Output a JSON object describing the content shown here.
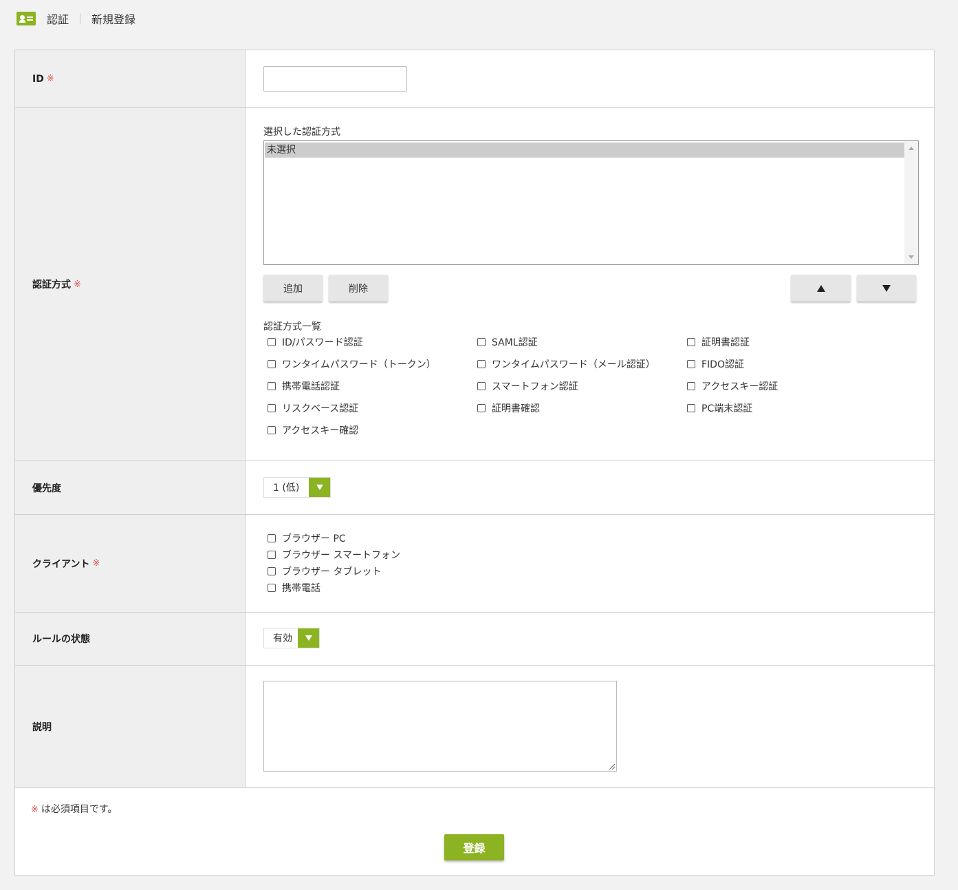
{
  "header": {
    "icon": "id-card-icon",
    "section": "認証",
    "page": "新規登録"
  },
  "required_mark": "※",
  "fields": {
    "id": {
      "label": "ID",
      "value": ""
    },
    "auth_method": {
      "label": "認証方式",
      "selected_label": "選択した認証方式",
      "selected_items": [
        "未選択"
      ],
      "add_button": "追加",
      "delete_button": "削除",
      "up_button_icon": "arrow-up-icon",
      "down_button_icon": "arrow-down-icon",
      "list_label": "認証方式一覧",
      "options": [
        "ID/パスワード認証",
        "SAML認証",
        "証明書認証",
        "ワンタイムパスワード（トークン）",
        "ワンタイムパスワード（メール認証）",
        "FIDO認証",
        "携帯電話認証",
        "スマートフォン認証",
        "アクセスキー認証",
        "リスクベース認証",
        "証明書確認",
        "PC端末認証",
        "アクセスキー確認"
      ]
    },
    "priority": {
      "label": "優先度",
      "value": "1 (低)"
    },
    "client": {
      "label": "クライアント",
      "options": [
        "ブラウザー PC",
        "ブラウザー スマートフォン",
        "ブラウザー タブレット",
        "携帯電話"
      ]
    },
    "rule_state": {
      "label": "ルールの状態",
      "value": "有効"
    },
    "description": {
      "label": "説明",
      "value": ""
    }
  },
  "footer": {
    "note": "は必須項目です。",
    "submit": "登録"
  },
  "colors": {
    "accent": "#8cb321",
    "required": "#d9534f"
  }
}
